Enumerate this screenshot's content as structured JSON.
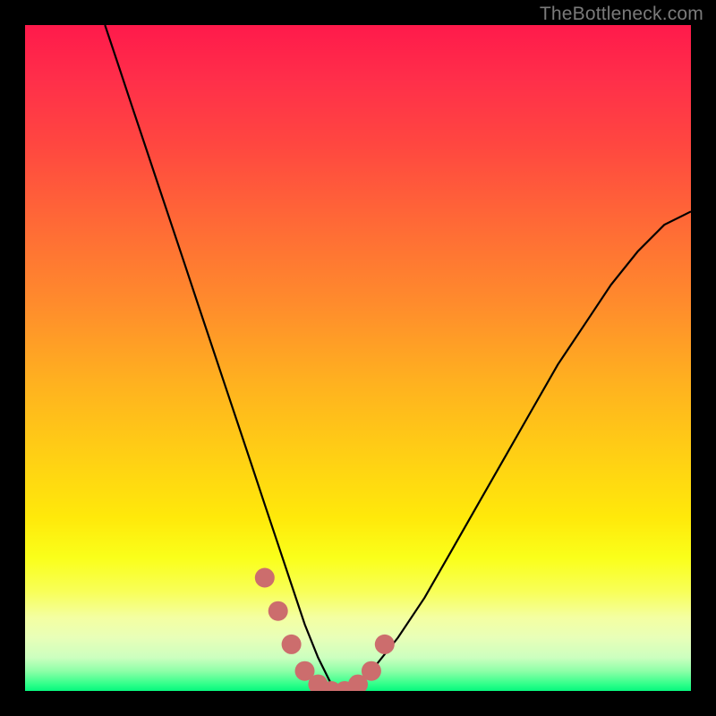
{
  "watermark": "TheBottleneck.com",
  "chart_data": {
    "type": "line",
    "title": "",
    "xlabel": "",
    "ylabel": "",
    "xlim": [
      0,
      100
    ],
    "ylim": [
      0,
      100
    ],
    "series": [
      {
        "name": "bottleneck-curve",
        "x": [
          12,
          14,
          16,
          18,
          20,
          22,
          24,
          26,
          28,
          30,
          32,
          34,
          36,
          38,
          40,
          42,
          44,
          46,
          48,
          50,
          52,
          56,
          60,
          64,
          68,
          72,
          76,
          80,
          84,
          88,
          92,
          96,
          100
        ],
        "values": [
          100,
          94,
          88,
          82,
          76,
          70,
          64,
          58,
          52,
          46,
          40,
          34,
          28,
          22,
          16,
          10,
          5,
          1,
          0,
          1,
          3,
          8,
          14,
          21,
          28,
          35,
          42,
          49,
          55,
          61,
          66,
          70,
          72
        ]
      },
      {
        "name": "marker-dots",
        "x": [
          36,
          38,
          40,
          42,
          44,
          46,
          48,
          50,
          52,
          54
        ],
        "values": [
          17,
          12,
          7,
          3,
          1,
          0,
          0,
          1,
          3,
          7
        ]
      }
    ],
    "colors": {
      "curve": "#000000",
      "markers": "#cc6d6d"
    }
  }
}
